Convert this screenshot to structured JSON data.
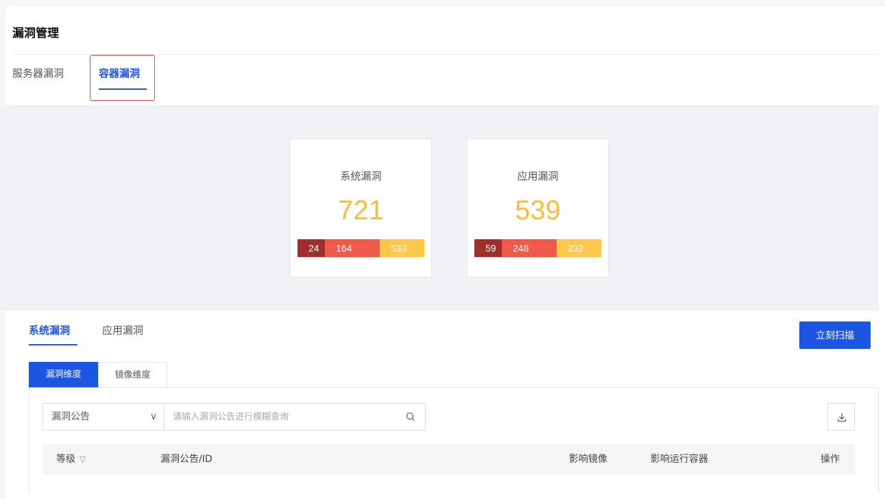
{
  "page": {
    "title": "漏洞管理"
  },
  "top_tabs": [
    {
      "label": "服务器漏洞",
      "active": false
    },
    {
      "label": "容器漏洞",
      "active": true
    }
  ],
  "stats": [
    {
      "title": "系统漏洞",
      "total": "721",
      "severity": {
        "critical": "24",
        "high": "164",
        "medium": "533"
      }
    },
    {
      "title": "应用漏洞",
      "total": "539",
      "severity": {
        "critical": "59",
        "high": "248",
        "medium": "232"
      }
    }
  ],
  "sub_tabs": [
    {
      "label": "系统漏洞",
      "active": true
    },
    {
      "label": "应用漏洞",
      "active": false
    }
  ],
  "scan_button": {
    "label": "立刻扫描"
  },
  "dimension_tabs": [
    {
      "label": "漏洞维度",
      "active": true
    },
    {
      "label": "镜像维度",
      "active": false
    }
  ],
  "filter": {
    "selected": "漏洞公告",
    "placeholder": "请输入漏洞公告进行模糊查询"
  },
  "table": {
    "headers": {
      "level": "等级",
      "notice": "漏洞公告/ID",
      "images": "影响镜像",
      "containers": "影响运行容器",
      "ops": "操作"
    }
  },
  "colors": {
    "accent": "#1b55e3",
    "critical": "#9e2f2a",
    "high": "#ef5a4b",
    "medium": "#fdc84a",
    "total_number": "#f5be3d"
  },
  "icons": {
    "select_chevron": "chevron-down-icon",
    "search": "search-icon",
    "download": "download-icon",
    "column_filter": "filter-icon"
  }
}
